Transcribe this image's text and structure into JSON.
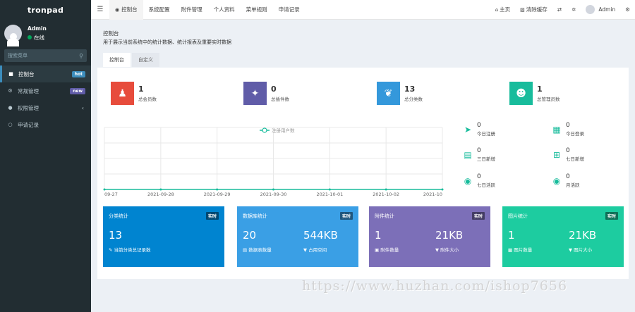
{
  "brand": "tronpad",
  "user": {
    "name": "Admin",
    "status": "在线",
    "status_color": "#00a65a"
  },
  "search": {
    "placeholder": "搜索菜单"
  },
  "sidebar": {
    "items": [
      {
        "label": "控制台",
        "icon": "dashboard-icon",
        "badge": "hot",
        "active": true
      },
      {
        "label": "常规管理",
        "icon": "cogs-icon",
        "badge": "new"
      },
      {
        "label": "权限管理",
        "icon": "group-icon",
        "chevron": "‹"
      },
      {
        "label": "申请记录",
        "icon": "circle-icon"
      }
    ]
  },
  "topbar": {
    "tabs": [
      {
        "label": "控制台",
        "icon": "dashboard-icon",
        "active": true
      },
      {
        "label": "系统配置"
      },
      {
        "label": "附件管理"
      },
      {
        "label": "个人资料"
      },
      {
        "label": "菜单规则"
      },
      {
        "label": "申请记录"
      }
    ],
    "right": {
      "home": "主页",
      "clear_cache": "清除缓存",
      "user": "Admin"
    }
  },
  "page": {
    "title": "控制台",
    "desc": "用于展示当前系统中的统计数据、统计报表及重要实时数据",
    "tabs": [
      "控制台",
      "自定义"
    ]
  },
  "stats": [
    {
      "value": "1",
      "label": "总会员数",
      "color": "#e74c3c",
      "icon": "users-icon"
    },
    {
      "value": "0",
      "label": "总插件数",
      "color": "#605ca8",
      "icon": "magic-icon"
    },
    {
      "value": "13",
      "label": "总分类数",
      "color": "#3498db",
      "icon": "leaf-icon"
    },
    {
      "value": "1",
      "label": "总管理员数",
      "color": "#18bc9c",
      "icon": "user-icon"
    }
  ],
  "chart_data": {
    "type": "line",
    "categories": [
      "09-27",
      "2021-09-28",
      "2021-09-29",
      "2021-09-30",
      "2021-10-01",
      "2021-10-02",
      "2021-10"
    ],
    "series": [
      {
        "name": "注册用户数",
        "values": [
          0,
          0,
          0,
          0,
          0,
          0,
          0
        ],
        "color": "#18bc9c"
      }
    ],
    "grid": true,
    "legend": "top-center"
  },
  "mini_stats": [
    {
      "value": "0",
      "label": "今日注册",
      "icon": "rocket-icon"
    },
    {
      "value": "0",
      "label": "今日登录",
      "icon": "vcard-icon"
    },
    {
      "value": "0",
      "label": "三日新增",
      "icon": "calendar-icon"
    },
    {
      "value": "0",
      "label": "七日新增",
      "icon": "calendar-plus-icon"
    },
    {
      "value": "0",
      "label": "七日活跃",
      "icon": "user-circle-icon"
    },
    {
      "value": "0",
      "label": "月活跃",
      "icon": "user-circle-icon"
    }
  ],
  "cards": [
    {
      "title": "分类统计",
      "badge": "实时",
      "color": "#0084d0",
      "v1": "13",
      "s1": "当前分类总记录数",
      "v2": "",
      "s2": ""
    },
    {
      "title": "数据库统计",
      "badge": "实时",
      "color": "#3a9fe5",
      "v1": "20",
      "s1": "数据表数量",
      "v2": "544KB",
      "s2": "占用空间"
    },
    {
      "title": "附件统计",
      "badge": "实时",
      "color": "#7c6fb8",
      "v1": "1",
      "s1": "附件数量",
      "v2": "21KB",
      "s2": "附件大小"
    },
    {
      "title": "图片统计",
      "badge": "实时",
      "color": "#1dcca0",
      "v1": "1",
      "s1": "图片数量",
      "v2": "21KB",
      "s2": "图片大小"
    }
  ],
  "watermark": "https://www.huzhan.com/ishop7656"
}
